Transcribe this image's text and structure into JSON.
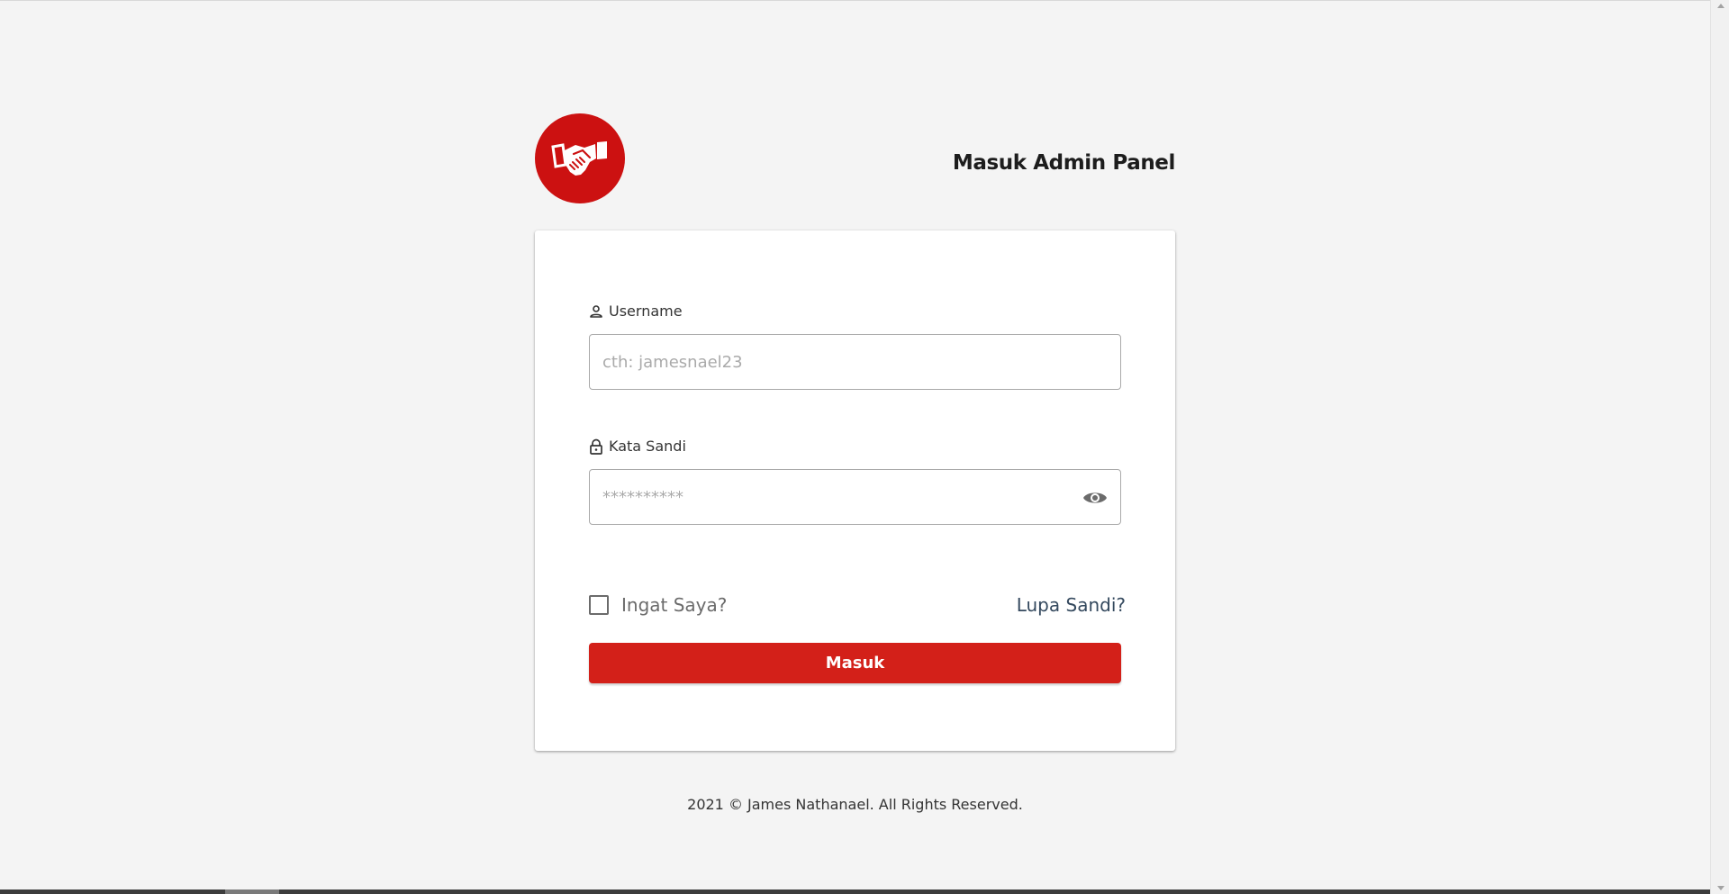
{
  "header": {
    "logo_icon": "handshake-icon",
    "title": "Masuk Admin Panel"
  },
  "form": {
    "username": {
      "icon": "person-icon",
      "label": "Username",
      "placeholder": "cth: jamesnael23",
      "value": ""
    },
    "password": {
      "icon": "lock-icon",
      "label": "Kata Sandi",
      "placeholder": "**********",
      "value": "",
      "toggle_icon": "eye-icon"
    },
    "remember_label": "Ingat Saya?",
    "remember_checked": false,
    "forgot_label": "Lupa Sandi?",
    "submit_label": "Masuk"
  },
  "footer": {
    "text": "2021 © James Nathanael. All Rights Reserved."
  },
  "colors": {
    "brand": "#cc1111",
    "button": "#d32019",
    "link": "#34495e",
    "background": "#f4f4f4"
  }
}
